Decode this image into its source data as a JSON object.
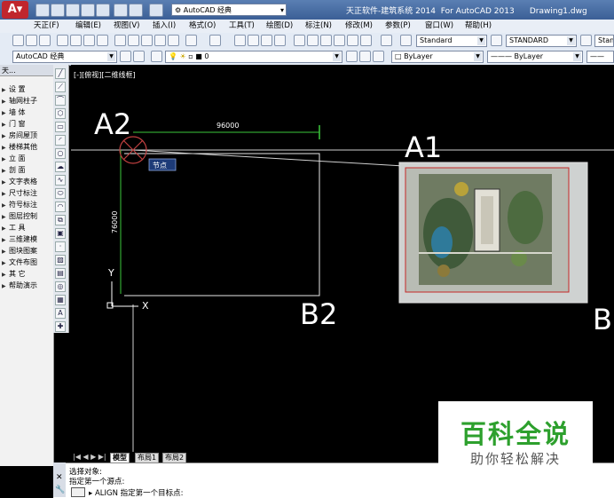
{
  "titlebar": {
    "workspace": "AutoCAD 经典",
    "title": "天正软件-建筑系统 2014  For AutoCAD 2013      Drawing1.dwg"
  },
  "menu": [
    "天正(F)",
    "编辑(E)",
    "视图(V)",
    "插入(I)",
    "格式(O)",
    "工具(T)",
    "绘图(D)",
    "标注(N)",
    "修改(M)",
    "参数(P)",
    "窗口(W)",
    "帮助(H)"
  ],
  "toolbar2": {
    "workspace": "AutoCAD 经典",
    "layer": "0",
    "text_style": "Standard",
    "dim_style": "STANDARD",
    "table_style": "Stan",
    "color": "ByLayer",
    "linetype": "ByLayer"
  },
  "tz_panel": {
    "header": "天...",
    "items": [
      "设    置",
      "轴网柱子",
      "墙    体",
      "门    窗",
      "房间屋顶",
      "楼梯其他",
      "立    面",
      "剖    面",
      "文字表格",
      "尺寸标注",
      "符号标注",
      "图层控制",
      "工    具",
      "三维建模",
      "图块图案",
      "文件布图",
      "其    它",
      "帮助演示"
    ]
  },
  "viewport": {
    "label": "[-][俯视][二维线框]",
    "labels": {
      "a2": "A2",
      "a1": "A1",
      "b2": "B2",
      "b_edge": "B"
    },
    "dim_h": "96000",
    "dim_v": "76000",
    "tooltip": "节点",
    "ucs_y": "Y",
    "ucs_x": "X"
  },
  "tabs": [
    "模型",
    "布局1",
    "布局2"
  ],
  "command": {
    "line1": "选择对象:",
    "line2": "指定第一个源点:",
    "prompt": "ALIGN 指定第一个目标点:"
  },
  "watermark": {
    "title": "百科全说",
    "subtitle": "助你轻松解决"
  }
}
